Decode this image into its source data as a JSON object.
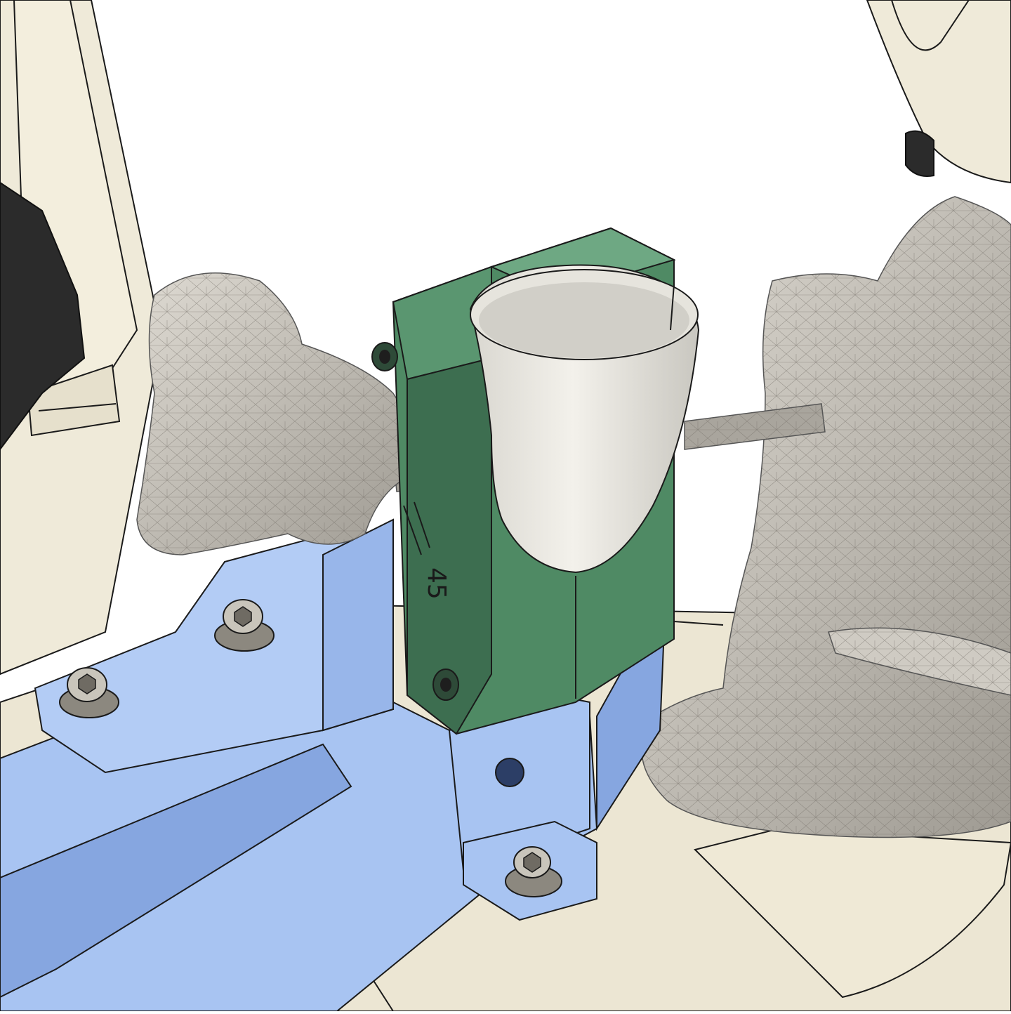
{
  "scene": {
    "engraving": {
      "angle_text": "45"
    },
    "colors": {
      "background": "#ffffff",
      "base_plate": "#ece6d3",
      "frame_cream": "#efead9",
      "frame_shadow": "#dcd6c2",
      "dark_part": "#2b2b2b",
      "blue_fixture": "#a8c4f2",
      "blue_fixture_shadow": "#86a6e0",
      "green_clamp": "#4f8a64",
      "green_clamp_dark": "#3d6e50",
      "cup_light": "#f1efe9",
      "cup_shadow": "#cfcdc6",
      "bone_mesh": "#b9b5ad",
      "bone_light": "#d8d4cc",
      "edge": "#1a1a1a",
      "bolt": "#c9c5bb",
      "bolt_dark": "#8c887f"
    },
    "icons": {
      "bolts": [
        "hex-socket-bolt-icon",
        "hex-socket-bolt-icon",
        "hex-socket-bolt-icon"
      ],
      "screws": [
        "socket-screw-icon",
        "socket-screw-icon"
      ]
    }
  }
}
